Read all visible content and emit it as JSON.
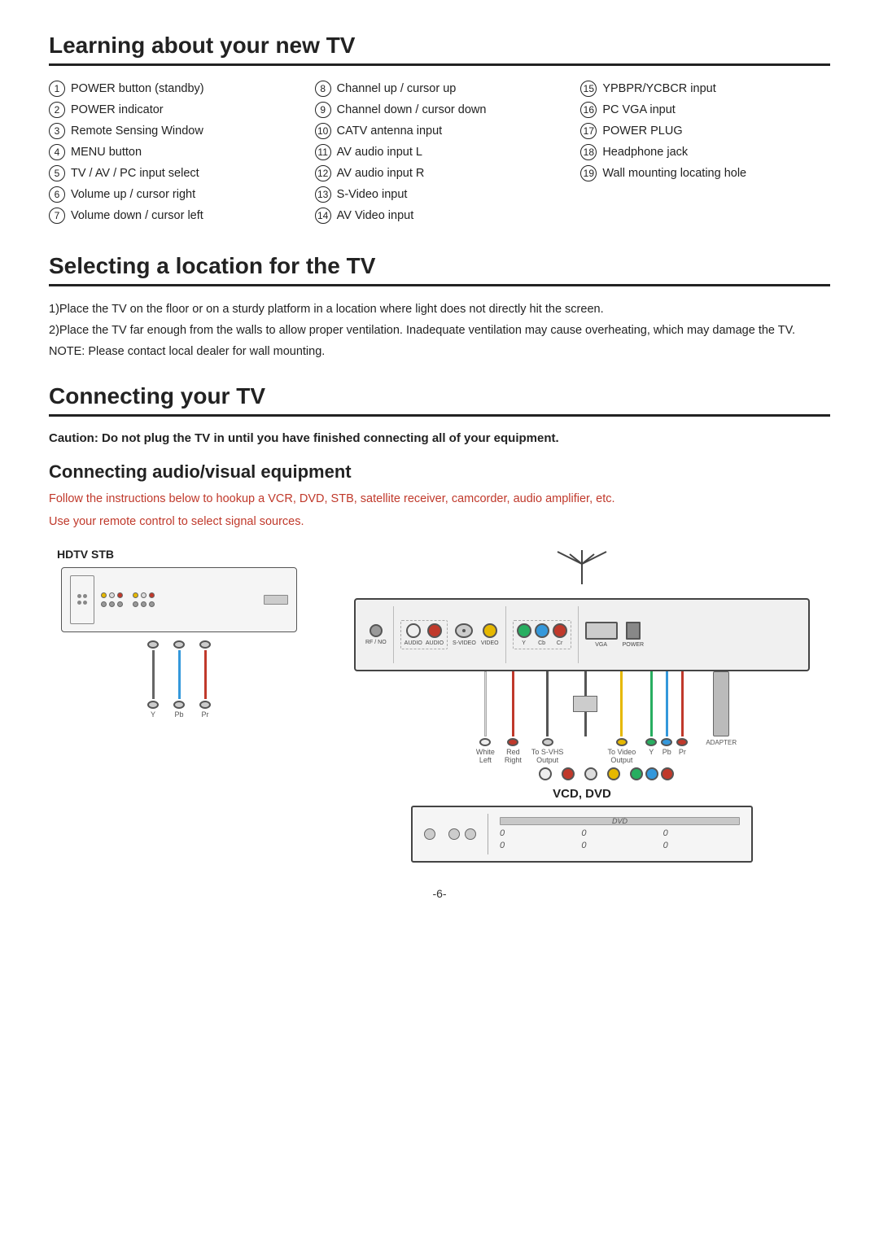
{
  "learning": {
    "title": "Learning about your new TV",
    "col1": [
      {
        "num": "1",
        "text": "POWER button (standby)"
      },
      {
        "num": "2",
        "text": "POWER indicator"
      },
      {
        "num": "3",
        "text": "Remote Sensing Window"
      },
      {
        "num": "4",
        "text": "MENU button"
      },
      {
        "num": "5",
        "text": "TV / AV / PC input select"
      },
      {
        "num": "6",
        "text": "Volume up / cursor right"
      },
      {
        "num": "7",
        "text": "Volume down / cursor left"
      }
    ],
    "col2": [
      {
        "num": "8",
        "text": "Channel up / cursor up"
      },
      {
        "num": "9",
        "text": "Channel down / cursor down"
      },
      {
        "num": "10",
        "text": "CATV antenna input"
      },
      {
        "num": "11",
        "text": "AV audio input L"
      },
      {
        "num": "12",
        "text": "AV audio input R"
      },
      {
        "num": "13",
        "text": "S-Video input"
      },
      {
        "num": "14",
        "text": "AV Video input"
      }
    ],
    "col3": [
      {
        "num": "15",
        "text": "YPBPR/YCBCR input"
      },
      {
        "num": "16",
        "text": "PC VGA input"
      },
      {
        "num": "17",
        "text": "POWER  PLUG"
      },
      {
        "num": "18",
        "text": "Headphone jack"
      },
      {
        "num": "19",
        "text": "Wall mounting locating hole"
      }
    ]
  },
  "selecting": {
    "title": "Selecting a location for the TV",
    "points": [
      "1)Place the TV on the floor or on a sturdy platform in a location where light does not directly hit the screen.",
      "2)Place the TV far enough from the walls to allow proper ventilation. Inadequate ventilation may cause overheating, which may damage the TV.",
      "NOTE: Please contact local dealer for wall mounting."
    ]
  },
  "connecting": {
    "title": "Connecting your TV",
    "caution": "Caution: Do not plug the TV in until you have finished connecting all of your equipment.",
    "av_title": "Connecting audio/visual equipment",
    "av_desc1": "Follow the instructions below to hookup a VCR, DVD, STB, satellite receiver, camcorder, audio amplifier, etc.",
    "av_desc2": "Use your remote control to select signal sources.",
    "hdtv_label": "HDTV STB",
    "vcd_dvd_label": "VCD, DVD",
    "panel_labels": {
      "rf": "RF / NO",
      "audio_l": "AUDIO",
      "audio_r": "AUDIO",
      "svideo": "S-VIDEO",
      "video": "VIDEO",
      "y": "Y",
      "pb": "Cb",
      "pr": "Cr",
      "vga": "VGA",
      "power": "POWER"
    },
    "cable_labels": {
      "y": "Y",
      "pb": "Pb",
      "pr": "Pr"
    }
  },
  "page_num": "-6-"
}
